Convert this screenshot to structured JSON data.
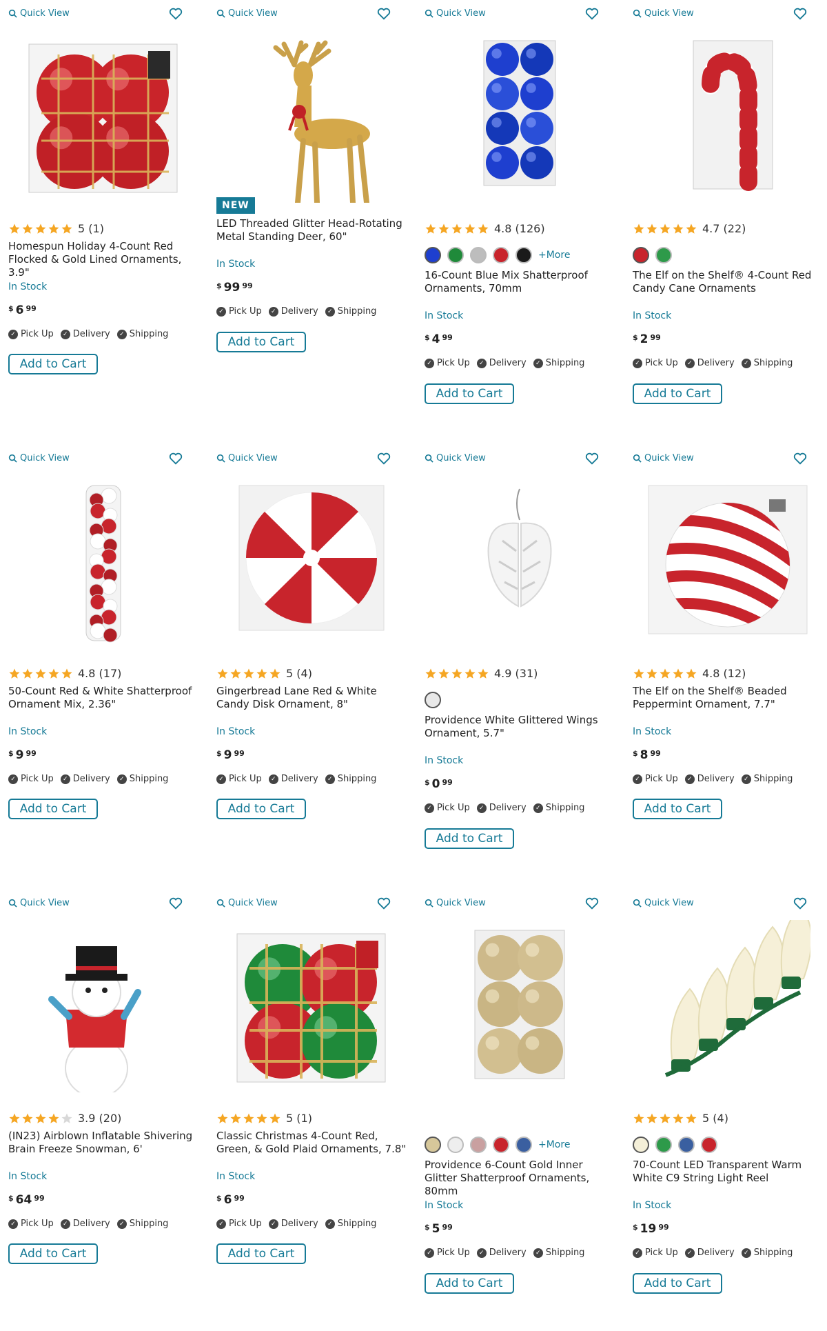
{
  "common": {
    "quick_view": "Quick View",
    "add_to_cart": "Add to Cart",
    "currency": "$",
    "fulfillment": [
      "Pick Up",
      "Delivery",
      "Shipping"
    ],
    "colors": {
      "accent": "#167a96",
      "star": "#f5a623"
    }
  },
  "products": [
    {
      "title": "Homespun Holiday 4-Count Red Flocked & Gold Lined Ornaments, 3.9\"",
      "rating_text": "5 (1)",
      "stars": 5,
      "stock": "In Stock",
      "price_dollars": "6",
      "price_cents": "99",
      "image": "red-plaid-ornaments"
    },
    {
      "title": "LED Threaded Glitter Head-Rotating Metal Standing Deer, 60\"",
      "badge": "NEW",
      "stock": "In Stock",
      "price_dollars": "99",
      "price_cents": "99",
      "image": "gold-deer"
    },
    {
      "title": "16-Count Blue Mix Shatterproof Ornaments, 70mm",
      "rating_text": "4.8 (126)",
      "stars": 5,
      "swatches": [
        "#1e3fcf",
        "#1f8a3a",
        "#bdbdbd",
        "#c8242c",
        "#1a1a1a"
      ],
      "more": "+More",
      "stock": "In Stock",
      "price_dollars": "4",
      "price_cents": "99",
      "image": "blue-ornaments"
    },
    {
      "title": "The Elf on the Shelf® 4-Count Red Candy Cane Ornaments",
      "rating_text": "4.7 (22)",
      "stars": 5,
      "swatches": [
        "#c8242c",
        "#2e9a4a"
      ],
      "stock": "In Stock",
      "price_dollars": "2",
      "price_cents": "99",
      "image": "candy-cane"
    },
    {
      "title": "50-Count Red & White Shatterproof Ornament Mix, 2.36\"",
      "rating_text": "4.8 (17)",
      "stars": 5,
      "stock": "In Stock",
      "price_dollars": "9",
      "price_cents": "99",
      "image": "tube-ornaments"
    },
    {
      "title": "Gingerbread Lane Red & White Candy Disk Ornament, 8\"",
      "rating_text": "5 (4)",
      "stars": 5,
      "stock": "In Stock",
      "price_dollars": "9",
      "price_cents": "99",
      "image": "peppermint-disk"
    },
    {
      "title": "Providence White Glittered Wings Ornament, 5.7\"",
      "rating_text": "4.9 (31)",
      "stars": 5,
      "swatches": [
        "#e8e8e8"
      ],
      "stock": "In Stock",
      "price_dollars": "0",
      "price_cents": "99",
      "image": "angel-wings"
    },
    {
      "title": "The Elf on the Shelf® Beaded Peppermint Ornament, 7.7\"",
      "rating_text": "4.8 (12)",
      "stars": 5,
      "stock": "In Stock",
      "price_dollars": "8",
      "price_cents": "99",
      "image": "striped-ball"
    },
    {
      "title": "(IN23) Airblown Inflatable Shivering Brain Freeze Snowman, 6'",
      "rating_text": "3.9 (20)",
      "stars": 4,
      "stock": "In Stock",
      "price_dollars": "64",
      "price_cents": "99",
      "image": "snowman-inflatable"
    },
    {
      "title": "Classic Christmas 4-Count Red, Green, & Gold Plaid Ornaments, 7.8\"",
      "rating_text": "5 (1)",
      "stars": 5,
      "stock": "In Stock",
      "price_dollars": "6",
      "price_cents": "99",
      "image": "plaid-ornaments"
    },
    {
      "title": "Providence 6-Count Gold Inner Glitter Shatterproof Ornaments, 80mm",
      "swatches": [
        "#d6c79a",
        "#eeeeee",
        "#c9a0a0",
        "#c8242c",
        "#3a5fa0"
      ],
      "more": "+More",
      "stock": "In Stock",
      "price_dollars": "5",
      "price_cents": "99",
      "image": "gold-ornaments"
    },
    {
      "title": "70-Count LED Transparent Warm White C9 String Light Reel",
      "rating_text": "5 (4)",
      "stars": 5,
      "swatches": [
        "#f4efd8",
        "#2e9a4a",
        "#3a5fa0",
        "#c8242c"
      ],
      "stock": "In Stock",
      "price_dollars": "19",
      "price_cents": "99",
      "image": "c9-lights"
    }
  ]
}
